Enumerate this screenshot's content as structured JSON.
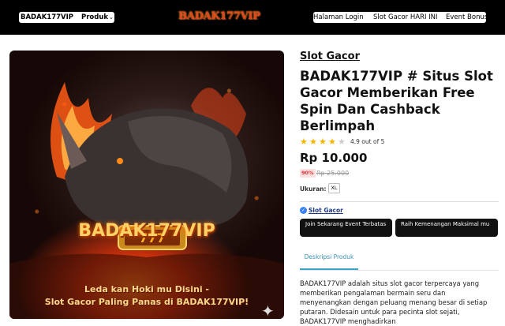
{
  "header": {
    "brand": "BADAK177VIP",
    "menu_label": "Produk",
    "logo_text": "BADAK177VIP",
    "nav": [
      "Halaman Login",
      "Slot Gacor HARI INI",
      "Event Bonus"
    ]
  },
  "hero": {
    "name": "BADAK177VIP",
    "tagline_1": "Leda kan Hoki mu Disini -",
    "tagline_2": "Slot Gacor Paling Panas di BADAK177VIP!"
  },
  "product": {
    "category": "Slot Gacor",
    "title": "BADAK177VIP # Situs Slot Gacor Memberikan Free Spin Dan Cashback Berlimpah",
    "rating": 4.9,
    "rating_text": "4.9 out of 5",
    "price": "Rp 10.000",
    "discount": "90%",
    "old_price": "Rp 25.000",
    "size_label": "Ukuran:",
    "size_value": "XL",
    "verified_label": "Slot Gacor",
    "buttons": [
      "Join Sekarang Event Terbatas",
      "Raih Kemenangan Maksimal mu"
    ],
    "tab_label": "Deskripsi Produk",
    "description": "BADAK177VIP adalah situs slot gacor terpercaya yang memberikan pengalaman bermain seru dan menyenangkan dengan peluang menang besar di setiap putaran. Didesain untuk para pecinta slot sejati, BADAK177VIP menghadirkan"
  },
  "colors": {
    "header_bg": "#000000",
    "accent_tab": "#3aa5c9",
    "star": "#f5b301",
    "discount_bg": "#fde0e0",
    "discount_text": "#dd3333"
  },
  "icons": [
    "chevron-down-icon",
    "star-icon",
    "verified-check-icon",
    "sparkle-icon"
  ]
}
